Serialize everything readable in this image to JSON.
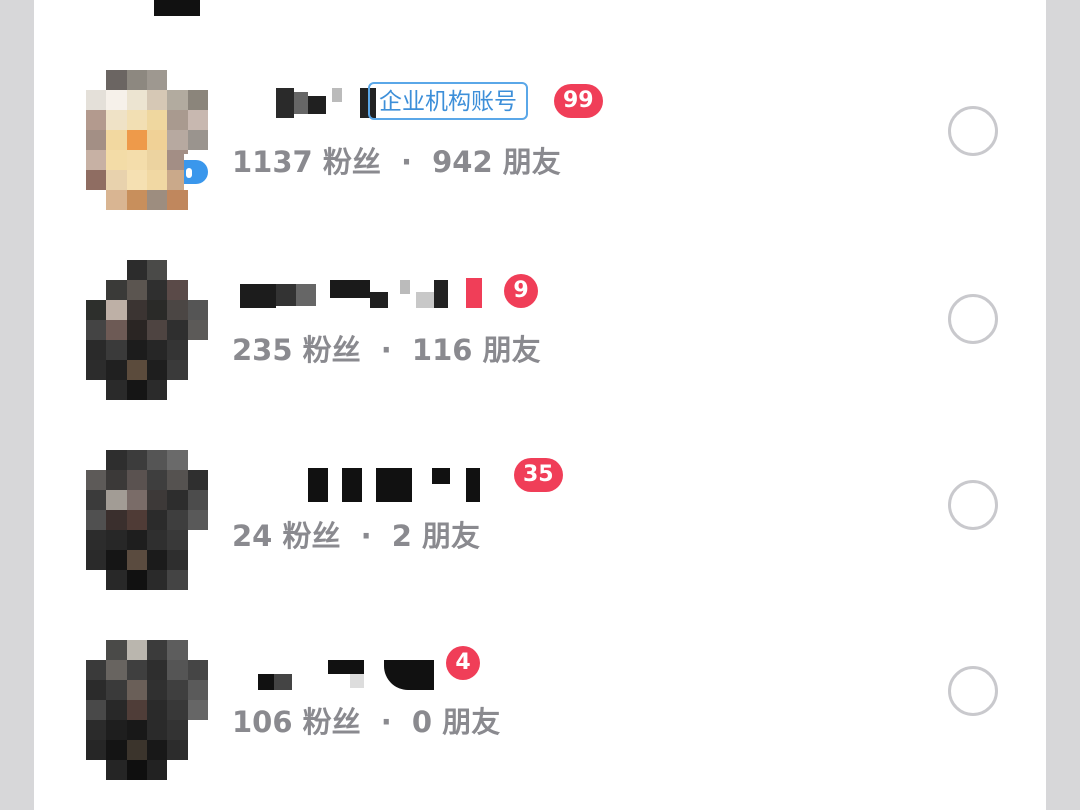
{
  "contacts": [
    {
      "tag": "企业机构账号",
      "badge": "99",
      "followers": "1137",
      "followers_label": "粉丝",
      "separator": "·",
      "friends": "942",
      "friends_label": "朋友",
      "selected": false
    },
    {
      "badge": "9",
      "followers": "235",
      "followers_label": "粉丝",
      "separator": "·",
      "friends": "116",
      "friends_label": "朋友",
      "selected": false
    },
    {
      "badge": "35",
      "followers": "24",
      "followers_label": "粉丝",
      "separator": "·",
      "friends": "2",
      "friends_label": "朋友",
      "selected": false
    },
    {
      "badge": "4",
      "followers": "106",
      "followers_label": "粉丝",
      "separator": "·",
      "friends": "0",
      "friends_label": "朋友",
      "selected": false
    }
  ],
  "colors": {
    "badge": "#f03e58",
    "tag_border": "#5aa7e8",
    "stats_text": "#8a8a8f",
    "radio_border": "#c9c9cd"
  }
}
